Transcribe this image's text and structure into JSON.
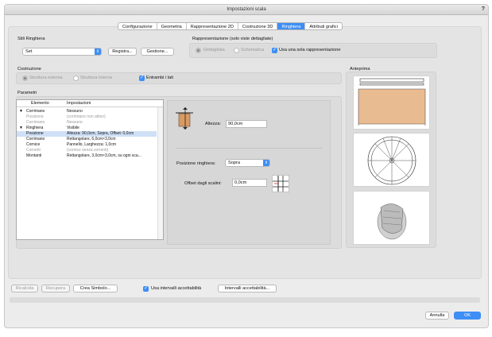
{
  "window": {
    "title": "Impostazioni scala",
    "help": "?"
  },
  "tabs": [
    {
      "label": "Configurazione"
    },
    {
      "label": "Geometria"
    },
    {
      "label": "Rappresentazione 2D"
    },
    {
      "label": "Costruzione 3D"
    },
    {
      "label": "Ringhiera"
    },
    {
      "label": "Attributi grafici"
    }
  ],
  "stili": {
    "heading": "Stili Ringhiera",
    "value": "Set",
    "registra": "Registra...",
    "gestione": "Gestione..."
  },
  "rappresentazione": {
    "heading": "Rappresentazione (solo viste dettagliate)",
    "dettagliata": "Dettagliata",
    "schematica": "Schematica",
    "usa_una": "Usa una sola rappresentazione"
  },
  "costruzione": {
    "heading": "Costruzione",
    "esterna": "Struttura esterna",
    "interna": "Struttura interna",
    "entrambi": "Entrambi i lati"
  },
  "parametri": {
    "heading": "Parametri",
    "col_elemento": "Elemento",
    "col_impostazioni": "Impostazioni",
    "rows": [
      {
        "toggle": "▼",
        "el": "Corrimano",
        "val": "Nessuno",
        "dim": false,
        "sel": false
      },
      {
        "toggle": "",
        "el": "Posizione",
        "val": "(corrimano non attivo)",
        "dim": true,
        "sel": false
      },
      {
        "toggle": "",
        "el": "Corrimano",
        "val": "Nessuno",
        "dim": true,
        "sel": false
      },
      {
        "toggle": "▼",
        "el": "Ringhiera",
        "val": "Visibile",
        "dim": false,
        "sel": false
      },
      {
        "toggle": "",
        "el": "Posizione",
        "val": "Altezza: 90,0cm, Sopra, Offset: 0,0cm",
        "dim": false,
        "sel": true
      },
      {
        "toggle": "",
        "el": "Corrimano",
        "val": "Rettangolare, 6,0cm×3,0cm",
        "dim": false,
        "sel": false
      },
      {
        "toggle": "",
        "el": "Cornice",
        "val": "Pannello, Larghezza: 1,0cm",
        "dim": false,
        "sel": false
      },
      {
        "toggle": "",
        "el": "Correnti",
        "val": "(cornice senza correnti)",
        "dim": true,
        "sel": false
      },
      {
        "toggle": "",
        "el": "Montanti",
        "val": "Rettangolare, 3,0cm×3,0cm, su ogni sca...",
        "dim": false,
        "sel": false
      }
    ]
  },
  "detail": {
    "altezza_label": "Altezza:",
    "altezza_value": "90,0cm",
    "posizione_label": "Posizione ringhiera:",
    "posizione_value": "Sopra",
    "offset_label": "Offset dagli scalini:",
    "offset_value": "0,0cm"
  },
  "anteprima": {
    "heading": "Anteprima"
  },
  "bottom": {
    "ricalcola": "Ricalcola",
    "recupera": "Recupera",
    "crea_simbolo": "Crea Simbolo...",
    "usa_intervalli": "Usa intervalli accettabilità",
    "intervalli": "Intervalli accettabilità...",
    "annulla": "Annulla",
    "ok": "OK"
  },
  "colors": {
    "accent": "#3d8ef5",
    "wood": "#e9bb90"
  }
}
